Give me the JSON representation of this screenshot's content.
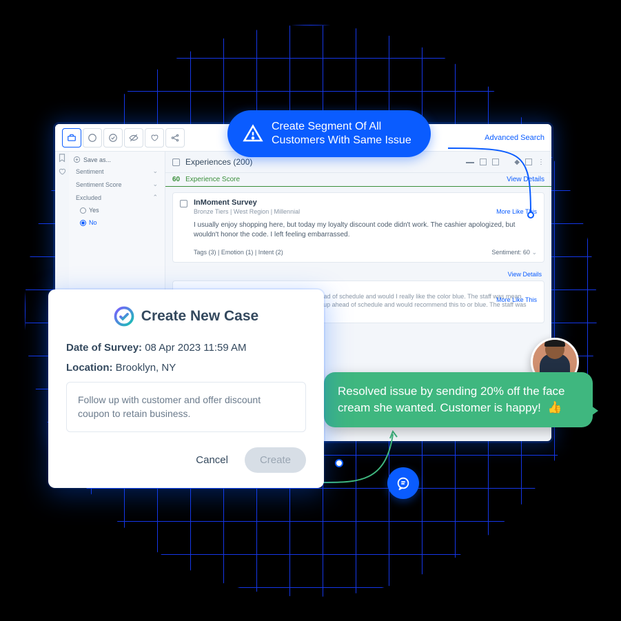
{
  "pill": {
    "text": "Create Segment Of All\nCustomers With Same Issue"
  },
  "app": {
    "advanced_search": "Advanced Search",
    "save_as": "Save as...",
    "filters": {
      "sentiment": "Sentiment",
      "sentiment_score": "Sentiment Score",
      "excluded": "Excluded",
      "yes": "Yes",
      "no": "No"
    },
    "experiences": {
      "title": "Experiences (200)",
      "score_num": "60",
      "score_label": "Experience Score",
      "view_details": "View Details"
    },
    "card1": {
      "title": "InMoment Survey",
      "meta": "Bronze Tiers | West Region | Millennial",
      "more_like_this": "More Like This",
      "body": "I usually enjoy shopping here, but today my loyalty discount code didn't work. The cashier apologized, but wouldn't honor the code. I left feeling embarrassed.",
      "tags": "Tags (3) | Emotion (1) | Intent (2)",
      "sentiment": "Sentiment: 60"
    },
    "card2": {
      "more_like_this": "More Like This",
      "body": "asy and shipping was free! My items showed up ahead of schedule and would I really like the color blue. The staff was mean though. My online order was free! My items showed up ahead of schedule and would recommend this to or blue. The staff was mean though."
    }
  },
  "modal": {
    "title": "Create New Case",
    "date_label": "Date of Survey:",
    "date_value": "08 Apr 2023 11:59 AM",
    "location_label": "Location:",
    "location_value": "Brooklyn, NY",
    "note": "Follow up with customer and offer discount coupon to retain business.",
    "cancel": "Cancel",
    "create": "Create"
  },
  "chat": {
    "text": "Resolved issue by sending 20% off the face cream she wanted. Customer is happy!",
    "emoji": "👍"
  }
}
